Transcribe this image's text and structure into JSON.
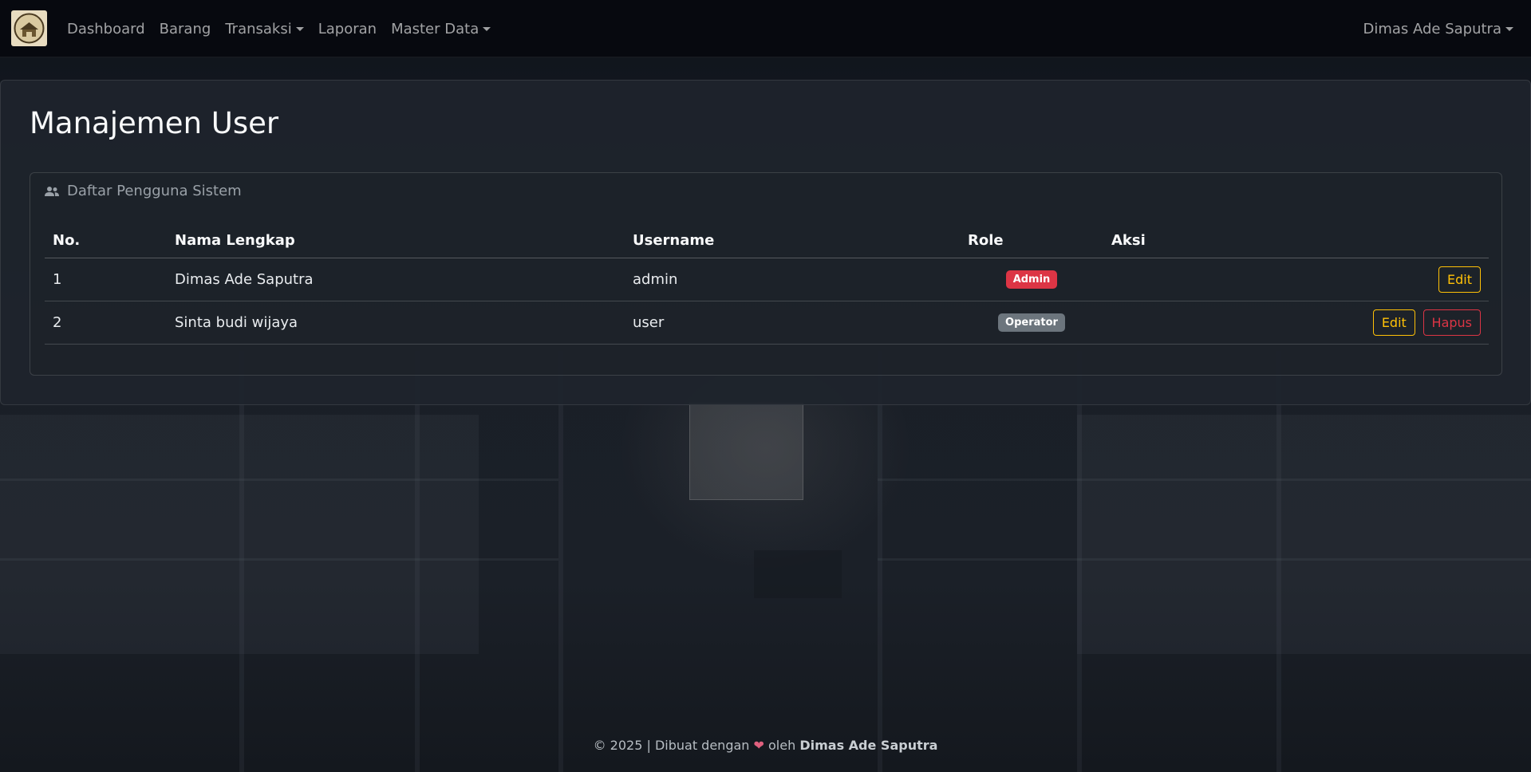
{
  "navbar": {
    "links": [
      {
        "label": "Dashboard"
      },
      {
        "label": "Barang"
      },
      {
        "label": "Transaksi",
        "dropdown": true
      },
      {
        "label": "Laporan"
      },
      {
        "label": "Master Data",
        "dropdown": true
      }
    ],
    "user_name": "Dimas Ade Saputra"
  },
  "page": {
    "title": "Manajemen User"
  },
  "card": {
    "header_icon": "users-icon",
    "header_label": "Daftar Pengguna Sistem"
  },
  "table": {
    "headers": {
      "no": "No.",
      "name": "Nama Lengkap",
      "username": "Username",
      "role": "Role",
      "aksi": "Aksi"
    },
    "rows": [
      {
        "no": "1",
        "name": "Dimas Ade Saputra",
        "username": "admin",
        "role": "Admin",
        "role_color": "#dc3545",
        "actions": [
          "Edit"
        ]
      },
      {
        "no": "2",
        "name": "Sinta budi wijaya",
        "username": "user",
        "role": "Operator",
        "role_color": "#6c757d",
        "actions": [
          "Edit",
          "Hapus"
        ]
      }
    ]
  },
  "footer": {
    "prefix": "© 2025 | Dibuat dengan",
    "middle": "oleh",
    "author": "Dimas Ade Saputra"
  },
  "colors": {
    "warning": "#ffc107",
    "danger": "#dc3545",
    "secondary": "#6c757d"
  }
}
